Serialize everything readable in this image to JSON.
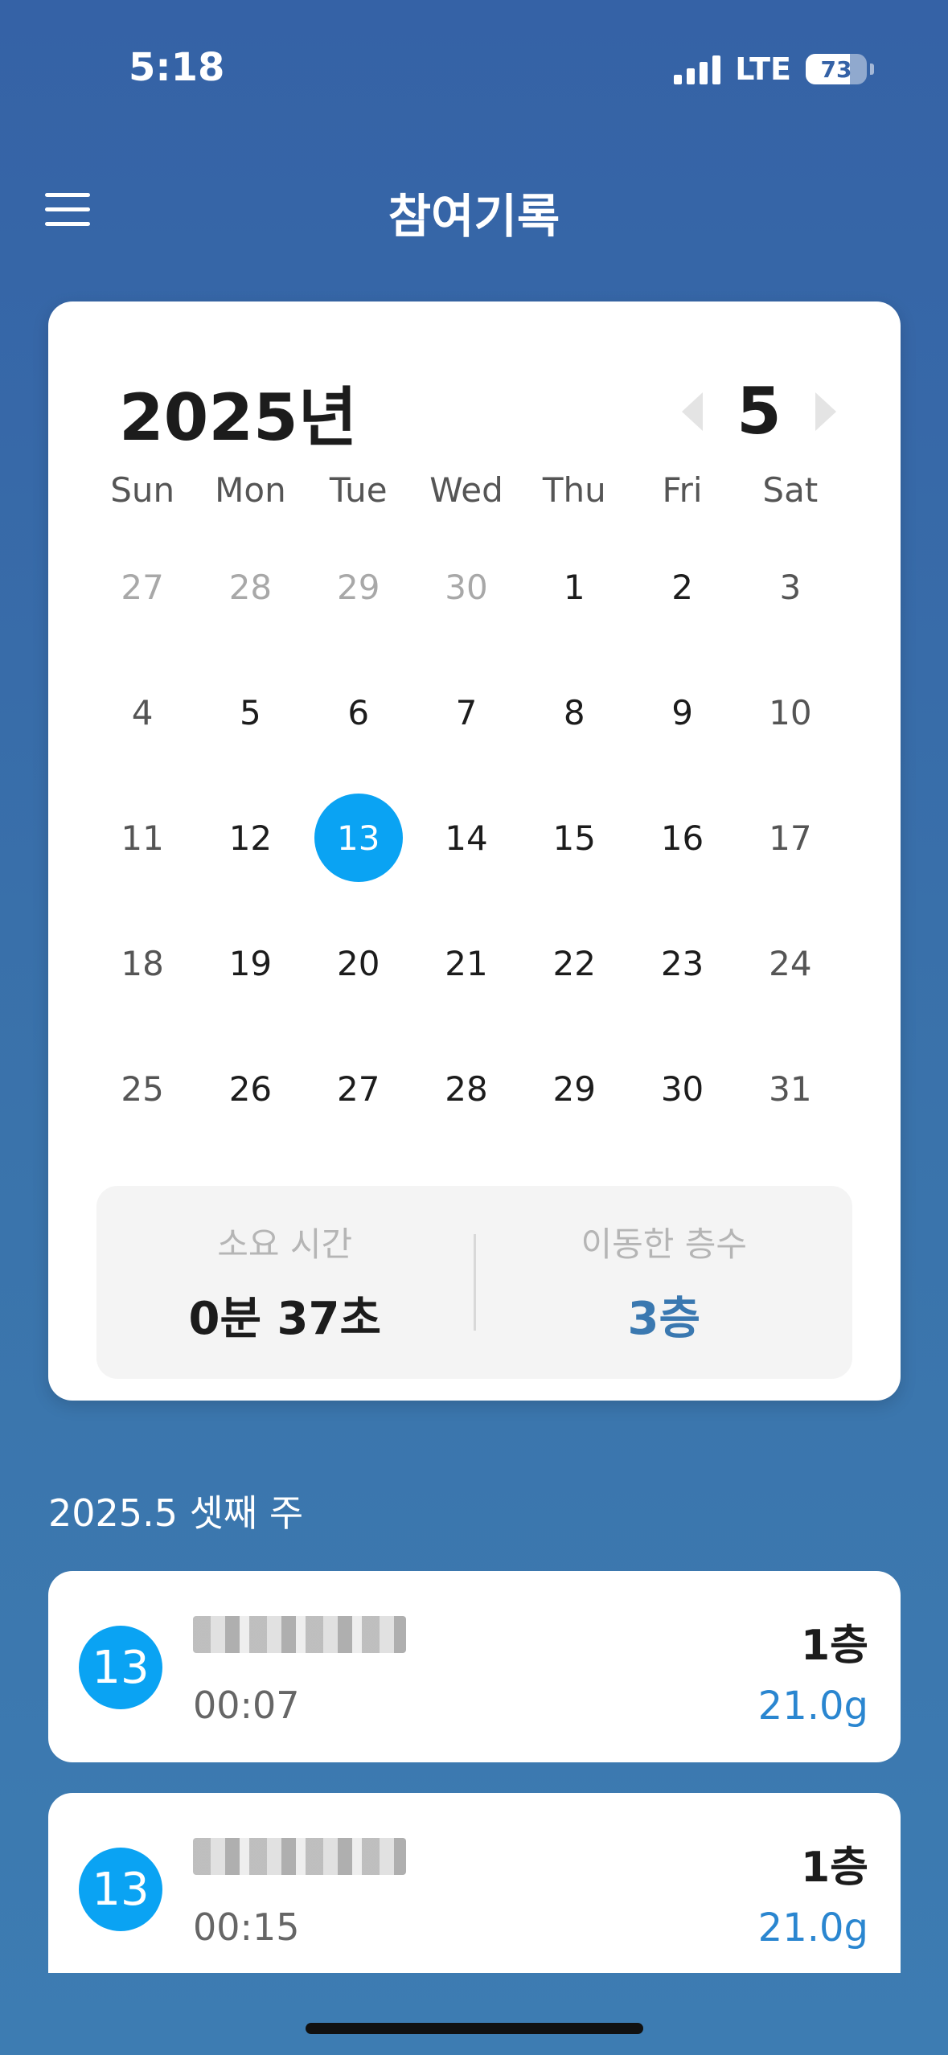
{
  "status_bar": {
    "time": "5:18",
    "network": "LTE",
    "battery": "73",
    "battery_level": 0.73
  },
  "header": {
    "title": "참여기록",
    "menu_icon": "hamburger-icon"
  },
  "calendar": {
    "year_label": "2025년",
    "month_label": "5",
    "weekdays": [
      "Sun",
      "Mon",
      "Tue",
      "Wed",
      "Thu",
      "Fri",
      "Sat"
    ],
    "weeks": [
      [
        {
          "d": "27",
          "muted": true
        },
        {
          "d": "28",
          "muted": true
        },
        {
          "d": "29",
          "muted": true
        },
        {
          "d": "30",
          "muted": true
        },
        {
          "d": "1"
        },
        {
          "d": "2"
        },
        {
          "d": "3"
        }
      ],
      [
        {
          "d": "4"
        },
        {
          "d": "5"
        },
        {
          "d": "6"
        },
        {
          "d": "7"
        },
        {
          "d": "8"
        },
        {
          "d": "9"
        },
        {
          "d": "10"
        }
      ],
      [
        {
          "d": "11"
        },
        {
          "d": "12"
        },
        {
          "d": "13",
          "selected": true
        },
        {
          "d": "14"
        },
        {
          "d": "15"
        },
        {
          "d": "16"
        },
        {
          "d": "17"
        }
      ],
      [
        {
          "d": "18"
        },
        {
          "d": "19"
        },
        {
          "d": "20"
        },
        {
          "d": "21"
        },
        {
          "d": "22"
        },
        {
          "d": "23"
        },
        {
          "d": "24"
        }
      ],
      [
        {
          "d": "25"
        },
        {
          "d": "26"
        },
        {
          "d": "27"
        },
        {
          "d": "28"
        },
        {
          "d": "29"
        },
        {
          "d": "30"
        },
        {
          "d": "31"
        }
      ]
    ],
    "summary": {
      "time_label": "소요 시간",
      "time_value": "0분 37초",
      "floors_label": "이동한 층수",
      "floors_value": "3층"
    }
  },
  "week": {
    "title": "2025.5 셋째 주",
    "records": [
      {
        "day": "13",
        "time": "00:07",
        "floor": "1층",
        "weight": "21.0g"
      },
      {
        "day": "13",
        "time": "00:15",
        "floor": "1층",
        "weight": "21.0g"
      }
    ]
  },
  "colors": {
    "accent": "#0aa3f3",
    "background": "#3562a6",
    "weight_text": "#2a86d0"
  }
}
